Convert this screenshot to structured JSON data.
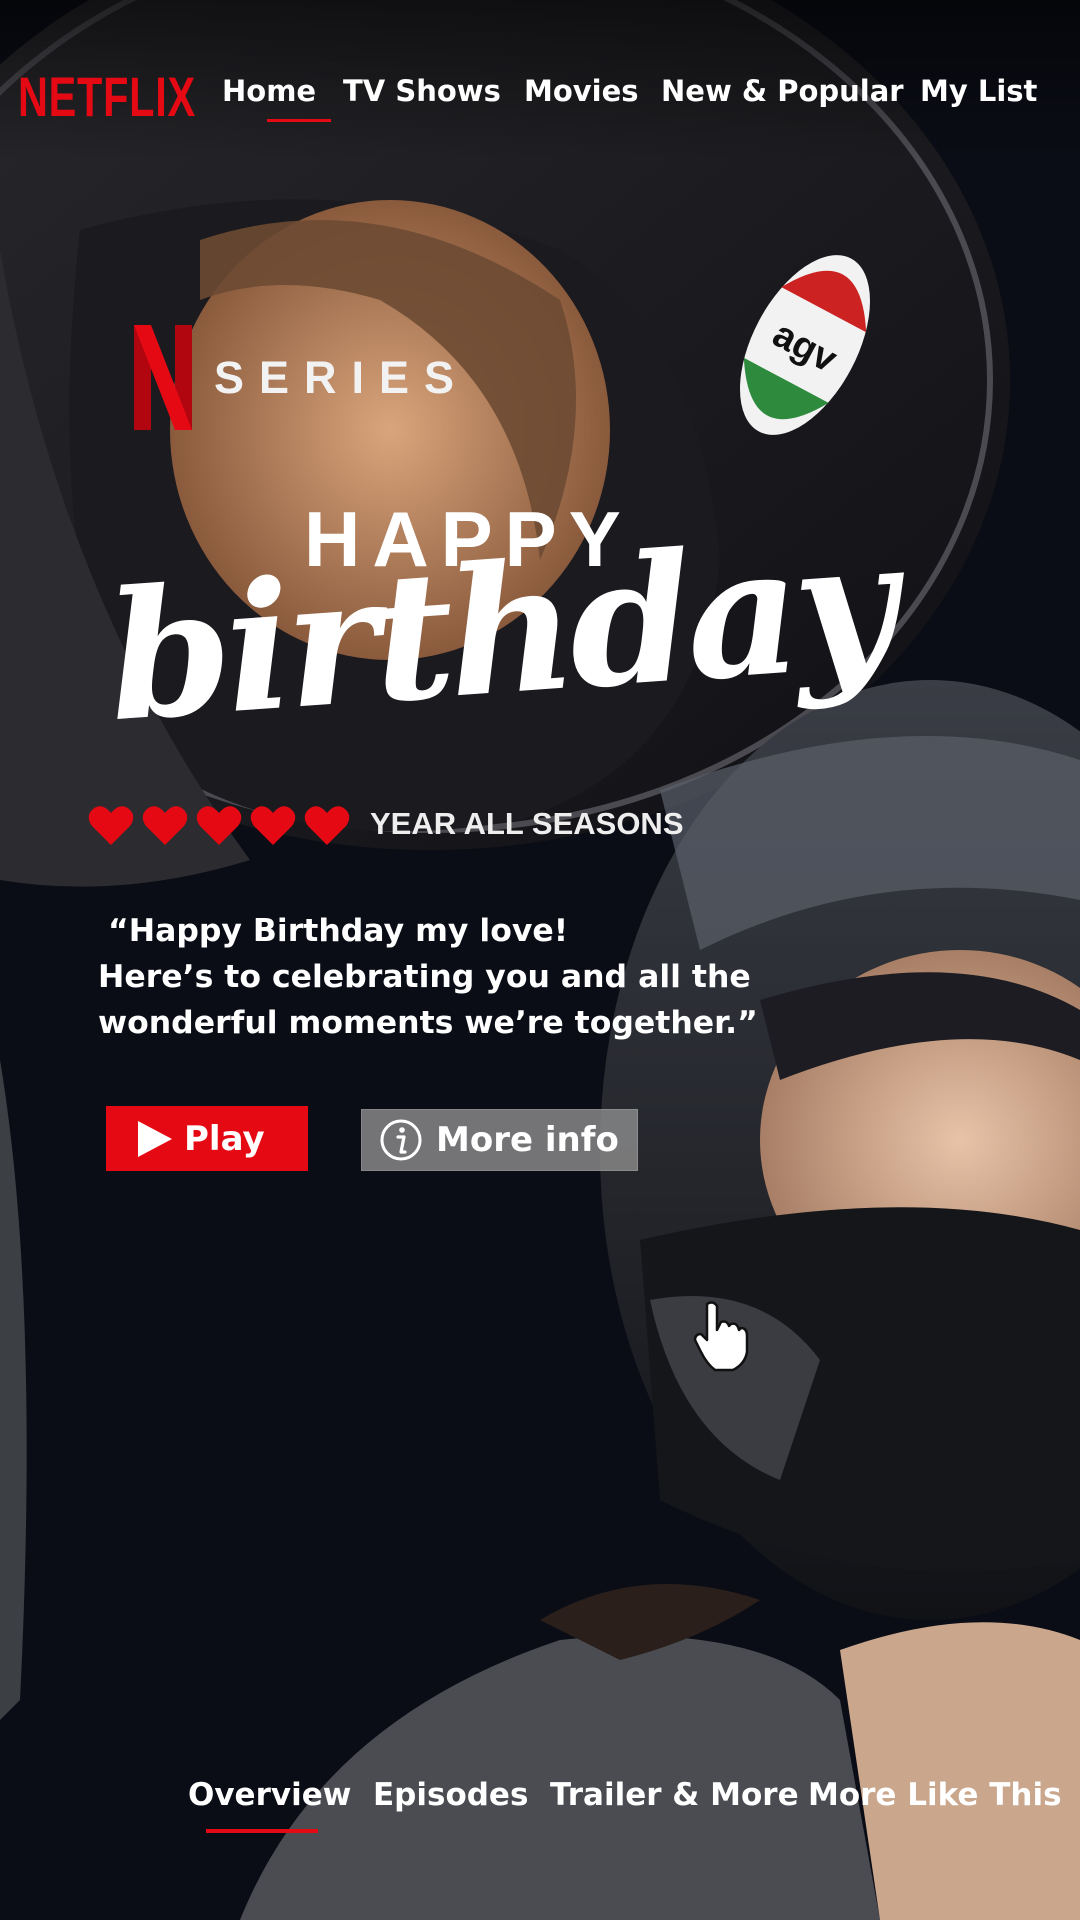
{
  "brand": {
    "logo_text": "NETFLIX",
    "accent_color": "#e50914"
  },
  "nav": {
    "items": [
      {
        "label": "Home",
        "active": true
      },
      {
        "label": "TV Shows",
        "active": false
      },
      {
        "label": "Movies",
        "active": false
      },
      {
        "label": "New & Popular",
        "active": false
      },
      {
        "label": "My List",
        "active": false
      }
    ]
  },
  "hero": {
    "badge_letter": "N",
    "badge_label": "SERIES",
    "title_line1": "HAPPY",
    "title_line2": "birthday",
    "hearts_count": 5,
    "heart_icon": "heart-icon",
    "season_text": "YEAR ALL SEASONS",
    "quote_lines": [
      "“Happy Birthday my love!",
      "Here’s to celebrating you and all the",
      "wonderful moments we’re together.”"
    ]
  },
  "actions": {
    "play": {
      "label": "Play",
      "icon": "play-icon"
    },
    "more_info": {
      "label": "More info",
      "icon": "info-icon"
    }
  },
  "tabs": [
    {
      "label": "Overview",
      "active": true
    },
    {
      "label": "Episodes",
      "active": false
    },
    {
      "label": "Trailer & More",
      "active": false
    },
    {
      "label": "More Like This",
      "active": false
    }
  ]
}
